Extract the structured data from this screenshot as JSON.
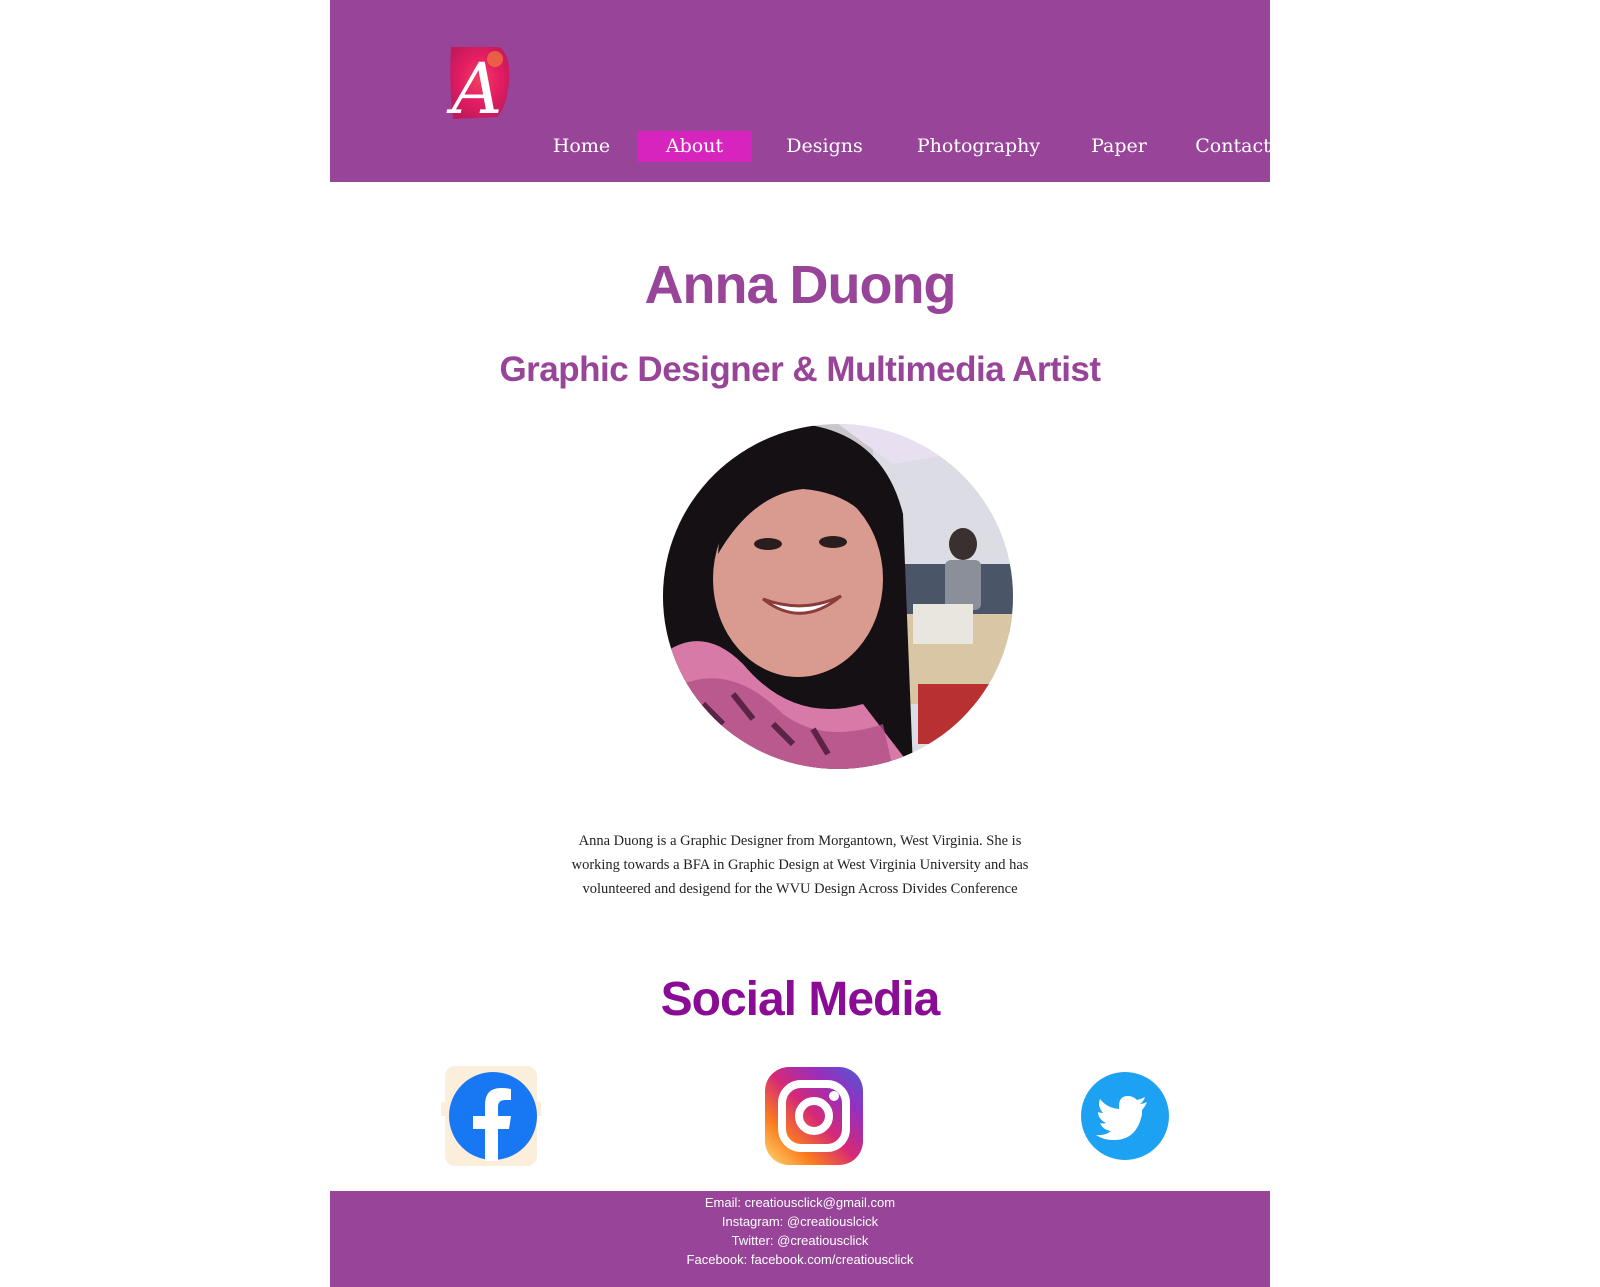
{
  "logo": {
    "letter": "A"
  },
  "nav": {
    "items": [
      {
        "label": "Home"
      },
      {
        "label": "About"
      },
      {
        "label": "Designs"
      },
      {
        "label": "Photography"
      },
      {
        "label": "Paper"
      },
      {
        "label": "Contact"
      }
    ],
    "active": "About"
  },
  "profile": {
    "name": "Anna Duong",
    "subtitle": "Graphic Designer & Multimedia Artist",
    "bio": "Anna Duong is a Graphic Designer from Morgantown, West Virginia. She is working towards a BFA in Graphic Design at West Virginia University and has volunteered and desigend for the WVU Design Across Divides Conference"
  },
  "social": {
    "title": "Social Media",
    "icons": [
      {
        "name": "facebook-icon"
      },
      {
        "name": "instagram-icon"
      },
      {
        "name": "twitter-icon"
      }
    ]
  },
  "footer": {
    "lines": [
      "Email: creatiousclick@gmail.com",
      "Instagram: @creatiouslcick",
      "Twitter: @creatiousclick",
      "Facebook: facebook.com/creatiousclick"
    ]
  },
  "colors": {
    "header_bg": "#974499",
    "nav_active": "#d824bf",
    "heading": "#974499",
    "social_heading": "#8b0c94",
    "facebook": "#1877f2",
    "twitter": "#1da1f2"
  }
}
